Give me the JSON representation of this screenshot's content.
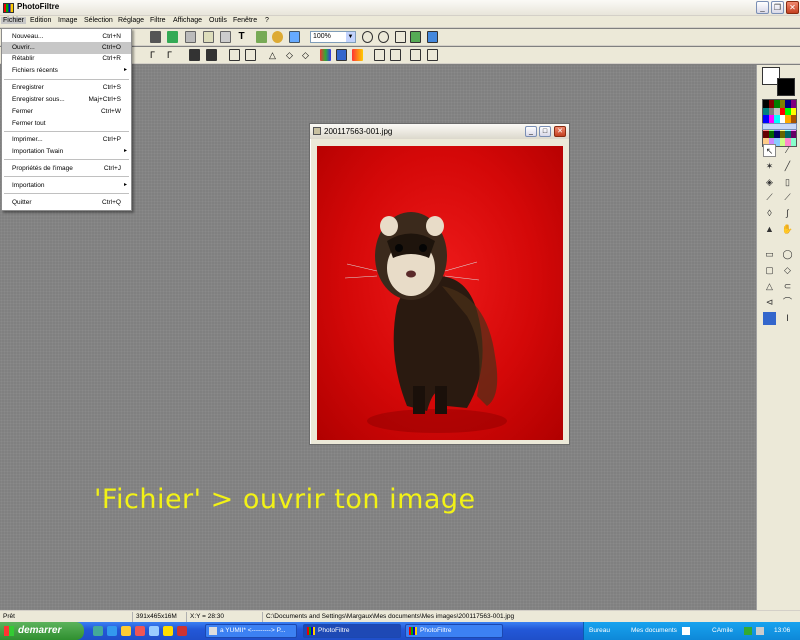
{
  "window": {
    "title": "PhotoFiltre"
  },
  "menubar": [
    "Fichier",
    "Edition",
    "Image",
    "Sélection",
    "Réglage",
    "Filtre",
    "Affichage",
    "Outils",
    "Fenêtre",
    "?"
  ],
  "toolbar": {
    "zoom": "100%"
  },
  "file_menu": {
    "items": [
      {
        "label": "Nouveau...",
        "shortcut": "Ctrl+N"
      },
      {
        "label": "Ouvrir...",
        "shortcut": "Ctrl+O"
      },
      {
        "label": "Rétablir",
        "shortcut": "Ctrl+R"
      },
      {
        "label": "Fichiers récents",
        "shortcut": ""
      },
      {
        "label": "Enregistrer",
        "shortcut": "Ctrl+S"
      },
      {
        "label": "Enregistrer sous...",
        "shortcut": "Maj+Ctrl+S"
      },
      {
        "label": "Fermer",
        "shortcut": "Ctrl+W"
      },
      {
        "label": "Fermer tout",
        "shortcut": ""
      },
      {
        "label": "Imprimer...",
        "shortcut": "Ctrl+P"
      },
      {
        "label": "Importation Twain",
        "shortcut": ""
      },
      {
        "label": "Propriétés de l'image",
        "shortcut": "Ctrl+J"
      },
      {
        "label": "Importation",
        "shortcut": ""
      },
      {
        "label": "Quitter",
        "shortcut": "Ctrl+Q"
      }
    ]
  },
  "image_window": {
    "title": "200117563-001.jpg"
  },
  "annotation": "'Fichier' > ouvrir ton image",
  "statusbar": {
    "state": "Prêt",
    "size": "391x465x16M",
    "coords": "X:Y = 28:30",
    "path": "C:\\Documents and Settings\\Margaux\\Mes documents\\Mes images\\200117563-001.jpg"
  },
  "taskbar": {
    "start": "demarrer",
    "tasks": [
      "a YUMII* <---------> P...",
      "PhotoFiltre",
      "PhotoFiltre"
    ],
    "tray": {
      "bureau": "Bureau",
      "docs": "Mes documents",
      "user": "CAmile",
      "time": "13:06"
    }
  },
  "colors": {
    "primary": "#ffffff",
    "secondary": "#000000",
    "photo_bg": "#d40808",
    "annotation": "#f2f216"
  }
}
